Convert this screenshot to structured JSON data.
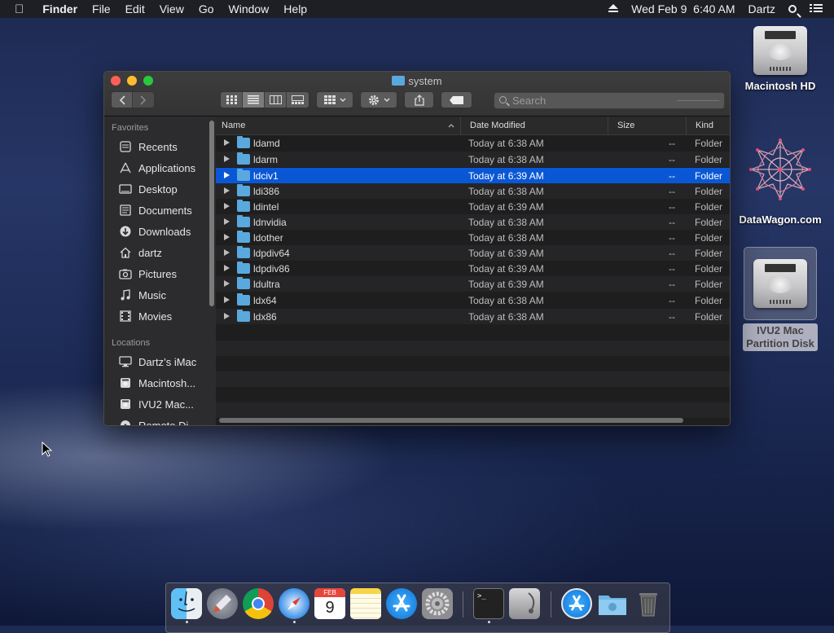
{
  "menubar": {
    "app": "Finder",
    "menus": [
      "File",
      "Edit",
      "View",
      "Go",
      "Window",
      "Help"
    ],
    "datetime": "Wed Feb 9  6:40 AM",
    "user": "Dartz"
  },
  "desktop": {
    "icons": [
      "Macintosh HD",
      "DataWagon.com"
    ],
    "selected_icon_line1": "IVU2 Mac",
    "selected_icon_line2": "Partition Disk"
  },
  "window": {
    "title": "system",
    "search_placeholder": "Search",
    "sidebar": {
      "favorites_header": "Favorites",
      "favorites": [
        {
          "label": "Recents",
          "icon": "recents-icon"
        },
        {
          "label": "Applications",
          "icon": "applications-icon"
        },
        {
          "label": "Desktop",
          "icon": "desktop-icon"
        },
        {
          "label": "Documents",
          "icon": "documents-icon"
        },
        {
          "label": "Downloads",
          "icon": "downloads-icon"
        },
        {
          "label": "dartz",
          "icon": "home-icon"
        },
        {
          "label": "Pictures",
          "icon": "pictures-icon"
        },
        {
          "label": "Music",
          "icon": "music-icon"
        },
        {
          "label": "Movies",
          "icon": "movies-icon"
        }
      ],
      "locations_header": "Locations",
      "locations": [
        {
          "label": "Dartz’s iMac",
          "icon": "imac-icon"
        },
        {
          "label": "Macintosh...",
          "icon": "disk-icon"
        },
        {
          "label": "IVU2 Mac...",
          "icon": "disk-icon"
        },
        {
          "label": "Remote Di...",
          "icon": "remote-disc-icon"
        }
      ]
    },
    "columns": {
      "name": "Name",
      "date": "Date Modified",
      "size": "Size",
      "kind": "Kind"
    },
    "files": [
      {
        "name": "ldamd",
        "date": "Today at 6:38 AM",
        "size": "--",
        "kind": "Folder"
      },
      {
        "name": "ldarm",
        "date": "Today at 6:38 AM",
        "size": "--",
        "kind": "Folder"
      },
      {
        "name": "ldciv1",
        "date": "Today at 6:39 AM",
        "size": "--",
        "kind": "Folder",
        "selected": true
      },
      {
        "name": "ldi386",
        "date": "Today at 6:38 AM",
        "size": "--",
        "kind": "Folder"
      },
      {
        "name": "ldintel",
        "date": "Today at 6:39 AM",
        "size": "--",
        "kind": "Folder"
      },
      {
        "name": "ldnvidia",
        "date": "Today at 6:38 AM",
        "size": "--",
        "kind": "Folder"
      },
      {
        "name": "ldother",
        "date": "Today at 6:38 AM",
        "size": "--",
        "kind": "Folder"
      },
      {
        "name": "ldpdiv64",
        "date": "Today at 6:39 AM",
        "size": "--",
        "kind": "Folder"
      },
      {
        "name": "ldpdiv86",
        "date": "Today at 6:39 AM",
        "size": "--",
        "kind": "Folder"
      },
      {
        "name": "ldultra",
        "date": "Today at 6:39 AM",
        "size": "--",
        "kind": "Folder"
      },
      {
        "name": "ldx64",
        "date": "Today at 6:38 AM",
        "size": "--",
        "kind": "Folder"
      },
      {
        "name": "ldx86",
        "date": "Today at 6:38 AM",
        "size": "--",
        "kind": "Folder"
      }
    ]
  },
  "dock": {
    "apps": [
      "finder-icon",
      "launchpad-icon",
      "chrome-icon",
      "safari-icon",
      "calendar-icon",
      "notes-icon",
      "app-store-icon",
      "system-preferences-icon",
      "terminal-icon",
      "disk-utility-icon",
      "app-store-download-icon",
      "folder-icon",
      "trash-icon"
    ],
    "calendar_month": "FEB",
    "calendar_day": "9",
    "terminal_prompt": ">_"
  },
  "colors": {
    "selection": "#0a57d6",
    "folder": "#5aa9de",
    "close": "#fe5f57",
    "minimize": "#febc2e",
    "zoom": "#28c840"
  }
}
